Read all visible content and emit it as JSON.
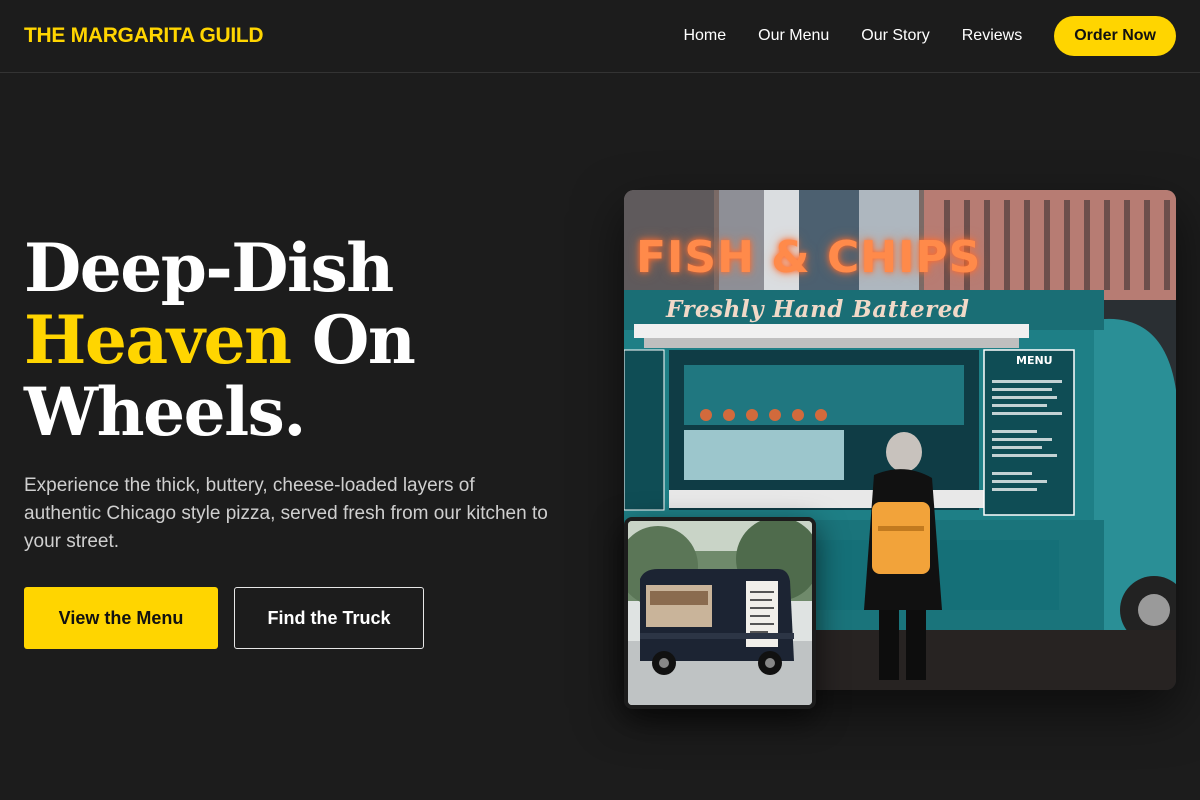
{
  "nav": {
    "brand": "THE MARGARITA GUILD",
    "links": [
      "Home",
      "Our Menu",
      "Our Story",
      "Reviews"
    ],
    "cta": "Order Now"
  },
  "hero": {
    "title_line1": "Deep-Dish",
    "title_accent": "Heaven",
    "title_rest": " On",
    "title_line3": "Wheels.",
    "subtitle": "Experience the thick, buttery, cheese-loaded layers of authentic Chicago style pizza, served fresh from our kitchen to your street.",
    "primary_button": "View the Menu",
    "secondary_button": "Find the Truck"
  },
  "images": {
    "main_sign": "FISH & CHIPS",
    "main_script": "Freshly Hand Battered",
    "menu_board": "MENU"
  },
  "colors": {
    "accent": "#ffd500",
    "background": "#1c1c1c"
  }
}
